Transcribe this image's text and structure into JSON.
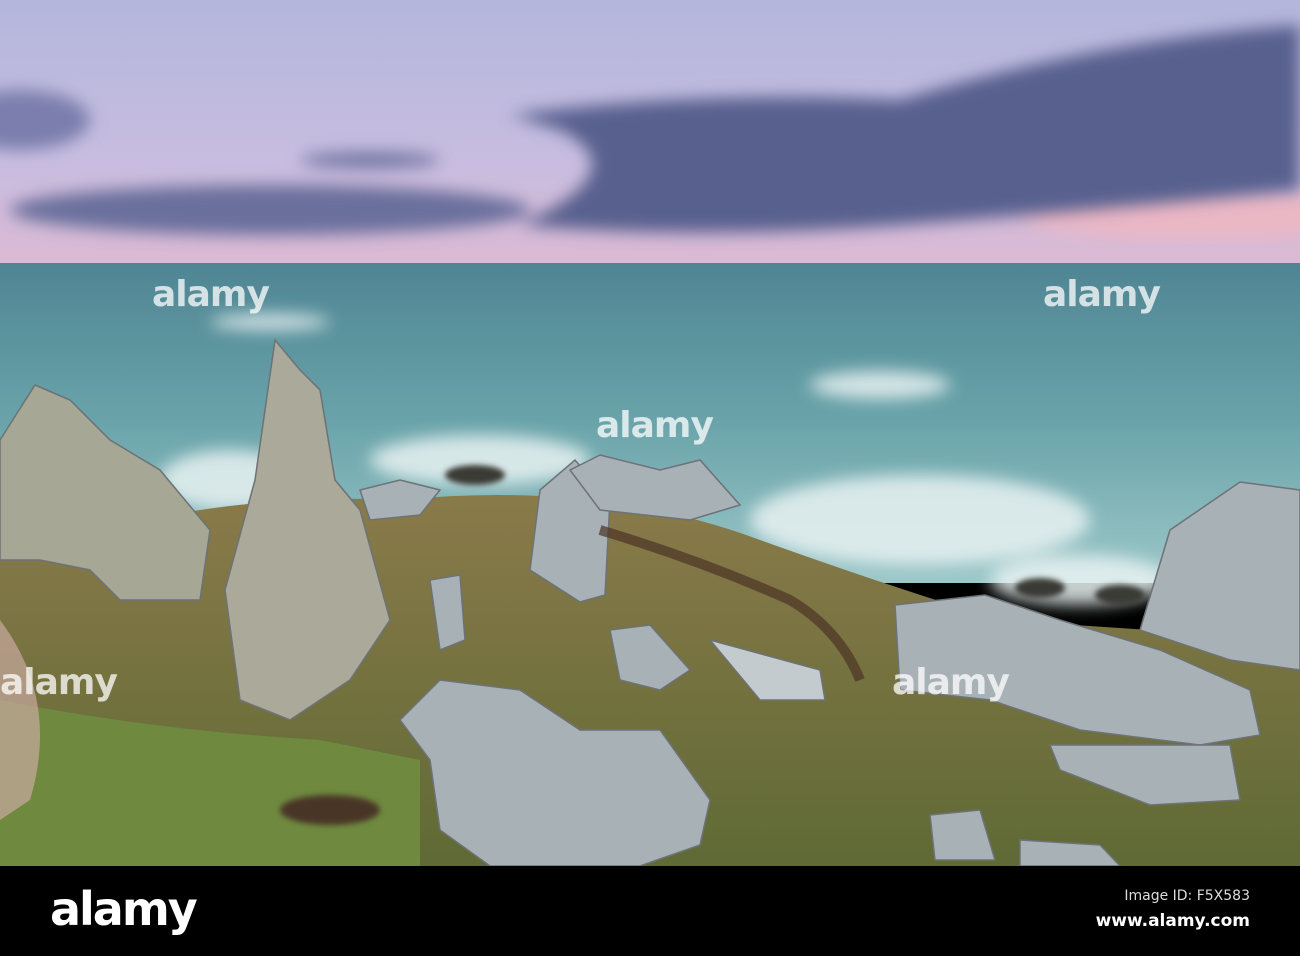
{
  "photo": {
    "subject": "Rocky coastline at dusk with long-exposure sea",
    "colors": {
      "sky_top": "#b9b9dc",
      "sky_pink": "#e6b8cc",
      "cloud": "#5a6391",
      "sea": "#5f9aa3",
      "rock": "#a8b3b8",
      "grass": "#7d7a45"
    }
  },
  "watermark": {
    "text": "alamy"
  },
  "footer": {
    "logo": "alamy",
    "image_id": "Image ID: F5X583",
    "site": "www.alamy.com"
  }
}
